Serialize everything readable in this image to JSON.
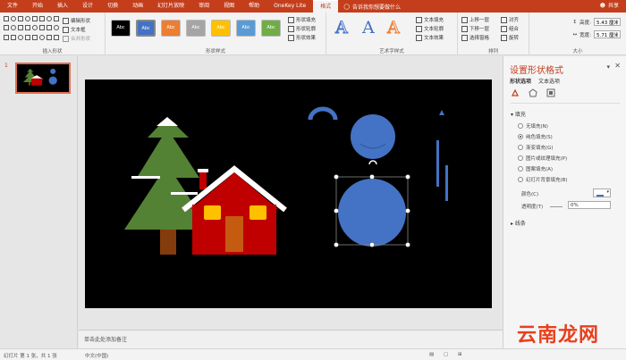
{
  "tabs": [
    "文件",
    "开始",
    "插入",
    "设计",
    "切换",
    "动画",
    "幻灯片放映",
    "审阅",
    "视图",
    "帮助",
    "OneKey Lite",
    "格式"
  ],
  "active_tab": "格式",
  "tell_me": "告诉我你想要做什么",
  "share": "共享",
  "ribbon": {
    "edit_shape": "编辑形状",
    "text_box": "文本框",
    "merge_shapes": "合并形状",
    "insert_shapes_label": "插入形状",
    "swatch_text": "Abc",
    "swatch_colors": [
      "#000000",
      "#4472c4",
      "#ed7d31",
      "#a5a5a5",
      "#ffc000",
      "#5b9bd5",
      "#70ad47"
    ],
    "shape_fill": "形状填充",
    "shape_outline": "形状轮廓",
    "shape_effects": "形状效果",
    "shape_styles_label": "形状样式",
    "wordart_letter": "A",
    "text_fill": "文本填充",
    "text_outline": "文本轮廓",
    "text_effects": "文本效果",
    "wordart_label": "艺术字样式",
    "bring_forward": "上移一层",
    "send_backward": "下移一层",
    "selection_pane": "选择窗格",
    "align": "对齐",
    "group": "组合",
    "rotate": "旋转",
    "arrange_label": "排列",
    "height_label": "高度:",
    "height_value": "5.43 厘米",
    "width_label": "宽度:",
    "width_value": "5.71 厘米",
    "size_label": "大小"
  },
  "slide_number": "1",
  "notes_placeholder": "单击此处添加备注",
  "pane": {
    "title": "设置形状格式",
    "tab_shape": "形状选项",
    "tab_text": "文本选项",
    "fill_section": "填充",
    "options": [
      "无填充(N)",
      "纯色填充(S)",
      "渐变填充(G)",
      "图片或纹理填充(P)",
      "图案填充(A)",
      "幻灯片背景填充(B)"
    ],
    "selected_option": 1,
    "color_label": "颜色(C)",
    "transparency_label": "透明度(T)",
    "transparency_value": "0%",
    "line_section": "线条"
  },
  "status": {
    "slide_info": "幻灯片 第 1 张，共 1 张",
    "language": "中文(中国)"
  },
  "watermark": "云南龙网",
  "colors": {
    "brand": "#c43e1c",
    "tree": "#548235",
    "trunk": "#843c0c",
    "house": "#c00000",
    "window": "#ffc000",
    "door": "#c55a11",
    "snowman": "#4472c4",
    "snow": "#ffffff"
  }
}
